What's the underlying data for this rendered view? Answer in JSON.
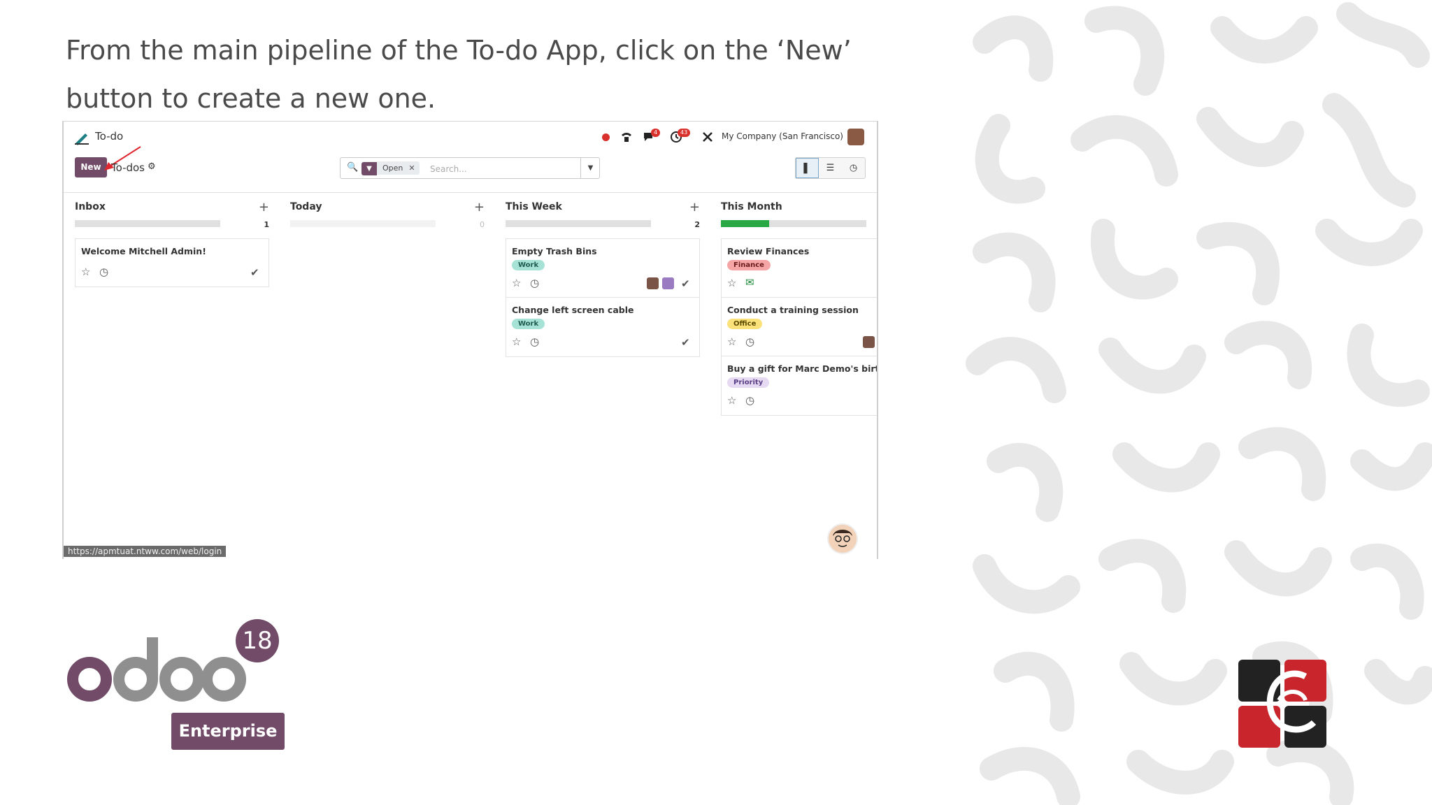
{
  "caption": "From the main pipeline of the To-do App, click on the ‘New’ button to create a new one.",
  "app": {
    "name": "To-do",
    "company": "My Company (San Francisco)",
    "chat_badge": "4",
    "activity_badge": "43"
  },
  "control": {
    "new_label": "New",
    "breadcrumb": "To-dos",
    "facet_label": "Open",
    "search_placeholder": "Search..."
  },
  "columns": [
    {
      "title": "Inbox",
      "count": "1",
      "progress": 0
    },
    {
      "title": "Today",
      "count": "0",
      "progress": 0
    },
    {
      "title": "This Week",
      "count": "2",
      "progress": 0
    },
    {
      "title": "This Month",
      "count": "",
      "progress": 0.33
    }
  ],
  "cards": {
    "inbox": [
      {
        "title": "Welcome Mitchell Admin!"
      }
    ],
    "this_week": [
      {
        "title": "Empty Trash Bins",
        "tag": "Work"
      },
      {
        "title": "Change left screen cable",
        "tag": "Work"
      }
    ],
    "this_month": [
      {
        "title": "Review Finances",
        "tag": "Finance"
      },
      {
        "title": "Conduct a training session",
        "tag": "Office"
      },
      {
        "title": "Buy a gift for Marc Demo's birth",
        "tag": "Priority"
      }
    ]
  },
  "status_url": "https://apmtuat.ntww.com/web/login",
  "branding": {
    "odoo_version": "18",
    "edition": "Enterprise"
  },
  "colors": {
    "brand": "#714b67",
    "work_tag": "#a6e3d6",
    "finance_tag": "#f5a5a5",
    "office_tag": "#fbe17a",
    "priority_tag": "#e6d9f2",
    "cg_red": "#c8252c",
    "cg_dark": "#222222"
  }
}
